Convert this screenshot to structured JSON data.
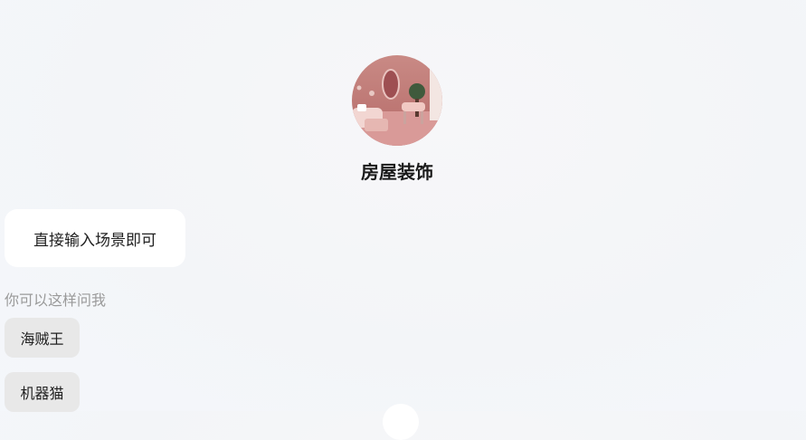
{
  "bot": {
    "name": "房屋装饰",
    "avatar_icon": "living-room-photo"
  },
  "welcome_message": "直接输入场景即可",
  "suggestions": {
    "hint": "你可以这样问我",
    "items": [
      {
        "label": "海贼王"
      },
      {
        "label": "机器猫"
      }
    ]
  }
}
